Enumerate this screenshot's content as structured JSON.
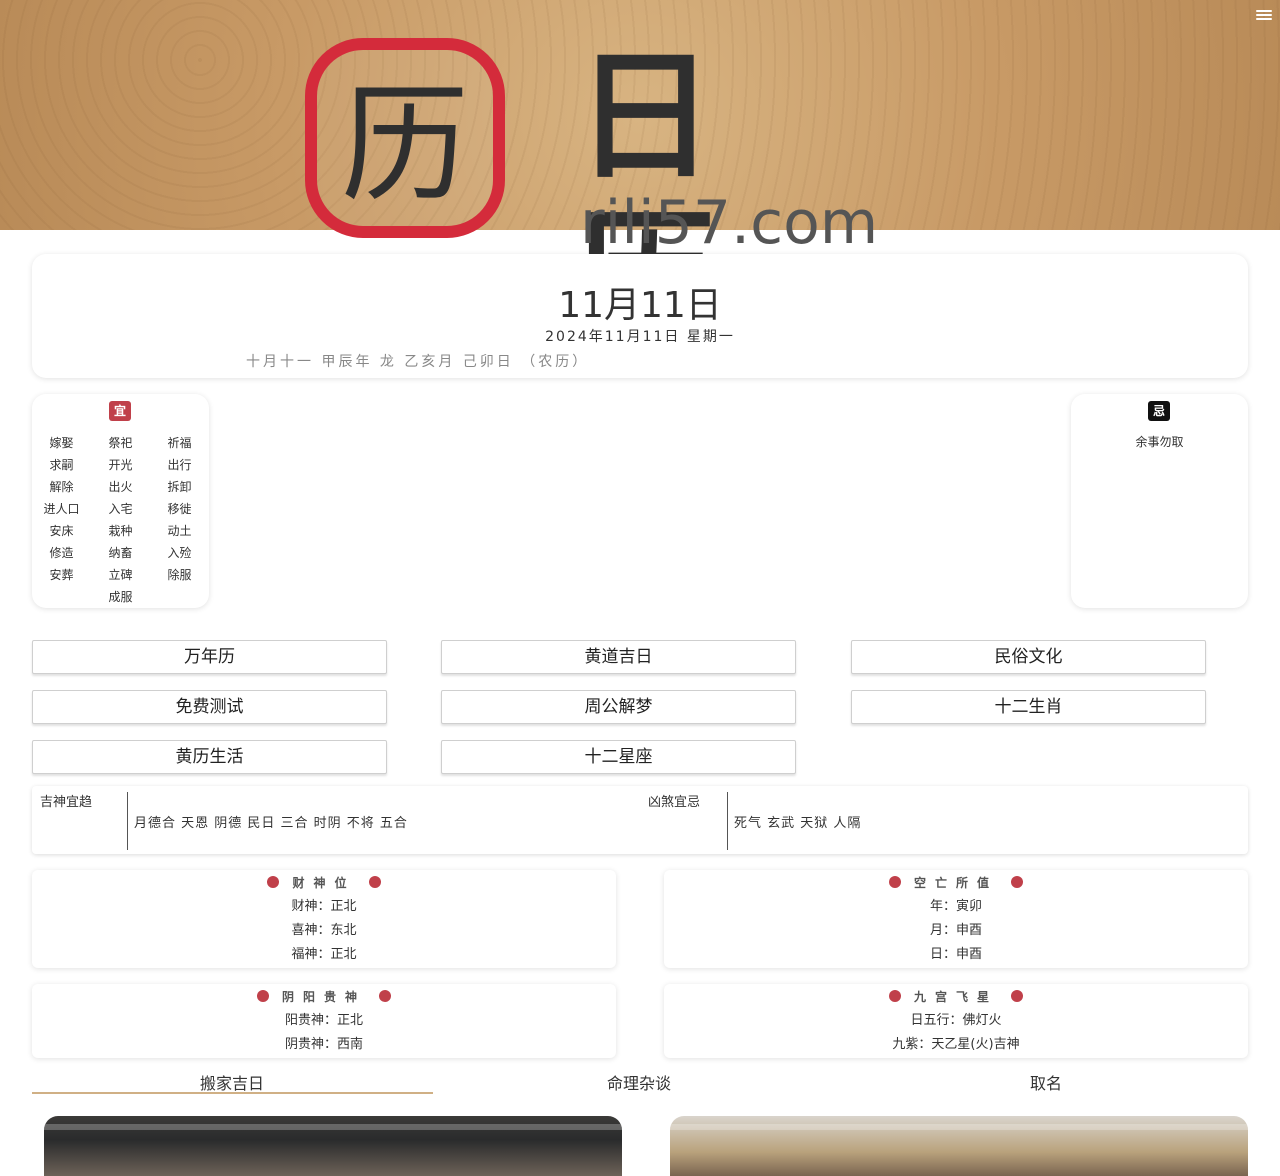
{
  "header": {
    "logo_glyph": "历",
    "logo_title": "日历",
    "logo_domain": "rili57.com",
    "menu_icon": "hamburger-menu-icon"
  },
  "date": {
    "main": "11月11日",
    "sub": "2024年11月11日 星期一",
    "lunar": "十月十一 甲辰年 龙 乙亥月 己卯日 （农历）"
  },
  "yi": {
    "tag": "宜",
    "items": [
      "嫁娶",
      "祭祀",
      "祈福",
      "求嗣",
      "开光",
      "出行",
      "解除",
      "出火",
      "拆卸",
      "进人口",
      "入宅",
      "移徙",
      "安床",
      "栽种",
      "动土",
      "修造",
      "纳畜",
      "入殓",
      "安葬",
      "立碑",
      "除服",
      "",
      "成服",
      ""
    ]
  },
  "ji": {
    "tag": "忌",
    "text": "余事勿取"
  },
  "nav": {
    "items": [
      "万年历",
      "黄道吉日",
      "民俗文化",
      "免费测试",
      "周公解梦",
      "十二生肖",
      "黄历生活",
      "十二星座"
    ]
  },
  "jishen": {
    "good_label": "吉神宜趋",
    "good_text": "月德合 天恩 阴德 民日 三合 时阴 不将 五合",
    "bad_label": "凶煞宜忌",
    "bad_text": "死气 玄武 天狱 人隔"
  },
  "caishen": {
    "title": "财神位",
    "lines": [
      "财神：正北",
      "喜神：东北",
      "福神：正北"
    ]
  },
  "kongwang": {
    "title": "空亡所值",
    "lines": [
      "年：寅卯",
      "月：申酉",
      "日：申酉"
    ]
  },
  "guishen": {
    "title": "阴阳贵神",
    "lines": [
      "阳贵神：正北",
      "阴贵神：西南"
    ]
  },
  "jiugong": {
    "title": "九宫飞星",
    "lines": [
      "日五行：佛灯火",
      "九紫：天乙星(火)吉神"
    ]
  },
  "tabs": {
    "items": [
      "搬家吉日",
      "命理杂谈",
      "取名"
    ],
    "active": 0
  },
  "colors": {
    "accent_red": "#c0404a",
    "yi_tag": "#c0404a",
    "ji_tag": "#111111",
    "tab_underline": "#d0b085"
  }
}
